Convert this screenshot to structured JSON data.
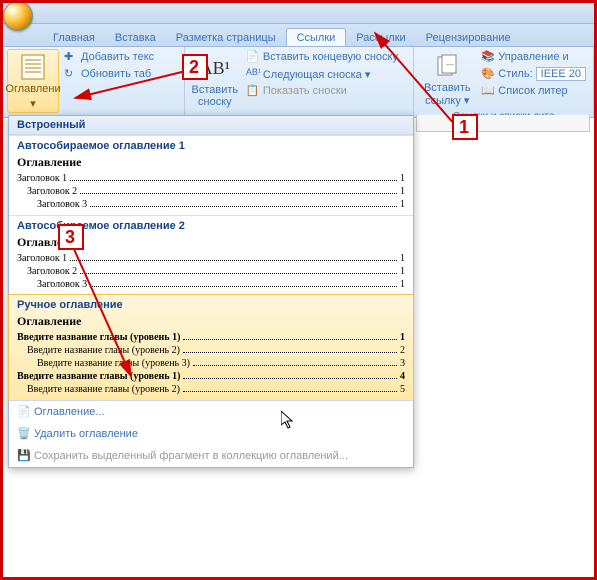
{
  "tabs": {
    "t0": "Главная",
    "t1": "Вставка",
    "t2": "Разметка страницы",
    "t3": "Ссылки",
    "t4": "Рассылки",
    "t5": "Рецензирование"
  },
  "ribbon": {
    "toc": {
      "label": "Оглавлени",
      "add": "Добавить текс",
      "update": "Обновить таб"
    },
    "footnote": {
      "big": "Вставить\nсноску",
      "ab": "AB¹",
      "end": "Вставить концевую сноску",
      "next": "Следующая сноска ▾",
      "show": "Показать сноски"
    },
    "link": {
      "big": "Вставить\nссылку ▾",
      "manage": "Управление и",
      "style_lbl": "Стиль:",
      "style_val": "IEEE 20",
      "bib": "Список литер",
      "caption": "Ссылки и списки лите"
    }
  },
  "dd": {
    "builtin": "Встроенный",
    "auto1": {
      "title": "Автособираемое оглавление 1",
      "heading": "Оглавление",
      "rows": [
        {
          "label": "Заголовок 1",
          "page": "1",
          "indent": 0
        },
        {
          "label": "Заголовок 2",
          "page": "1",
          "indent": 1
        },
        {
          "label": "Заголовок 3",
          "page": "1",
          "indent": 2
        }
      ]
    },
    "auto2": {
      "title": "Автособираемое оглавление 2",
      "heading": "Оглавление",
      "rows": [
        {
          "label": "Заголовок 1",
          "page": "1",
          "indent": 0
        },
        {
          "label": "Заголовок 2",
          "page": "1",
          "indent": 1
        },
        {
          "label": "Заголовок 3",
          "page": "1",
          "indent": 2
        }
      ]
    },
    "manual": {
      "title": "Ручное оглавление",
      "heading": "Оглавление",
      "rows": [
        {
          "label": "Введите название главы (уровень 1)",
          "page": "1",
          "indent": 0,
          "bold": true
        },
        {
          "label": "Введите название главы (уровень 2)",
          "page": "2",
          "indent": 1
        },
        {
          "label": "Введите название главы (уровень 3)",
          "page": "3",
          "indent": 2
        },
        {
          "label": "Введите название главы (уровень 1)",
          "page": "4",
          "indent": 0,
          "bold": true
        },
        {
          "label": "Введите название главы (уровень 2)",
          "page": "5",
          "indent": 1
        }
      ]
    },
    "custom": "Оглавление...",
    "remove": "Удалить оглавление",
    "save": "Сохранить выделенный фрагмент в коллекцию оглавлений..."
  },
  "ann": {
    "n1": "1",
    "n2": "2",
    "n3": "3"
  }
}
